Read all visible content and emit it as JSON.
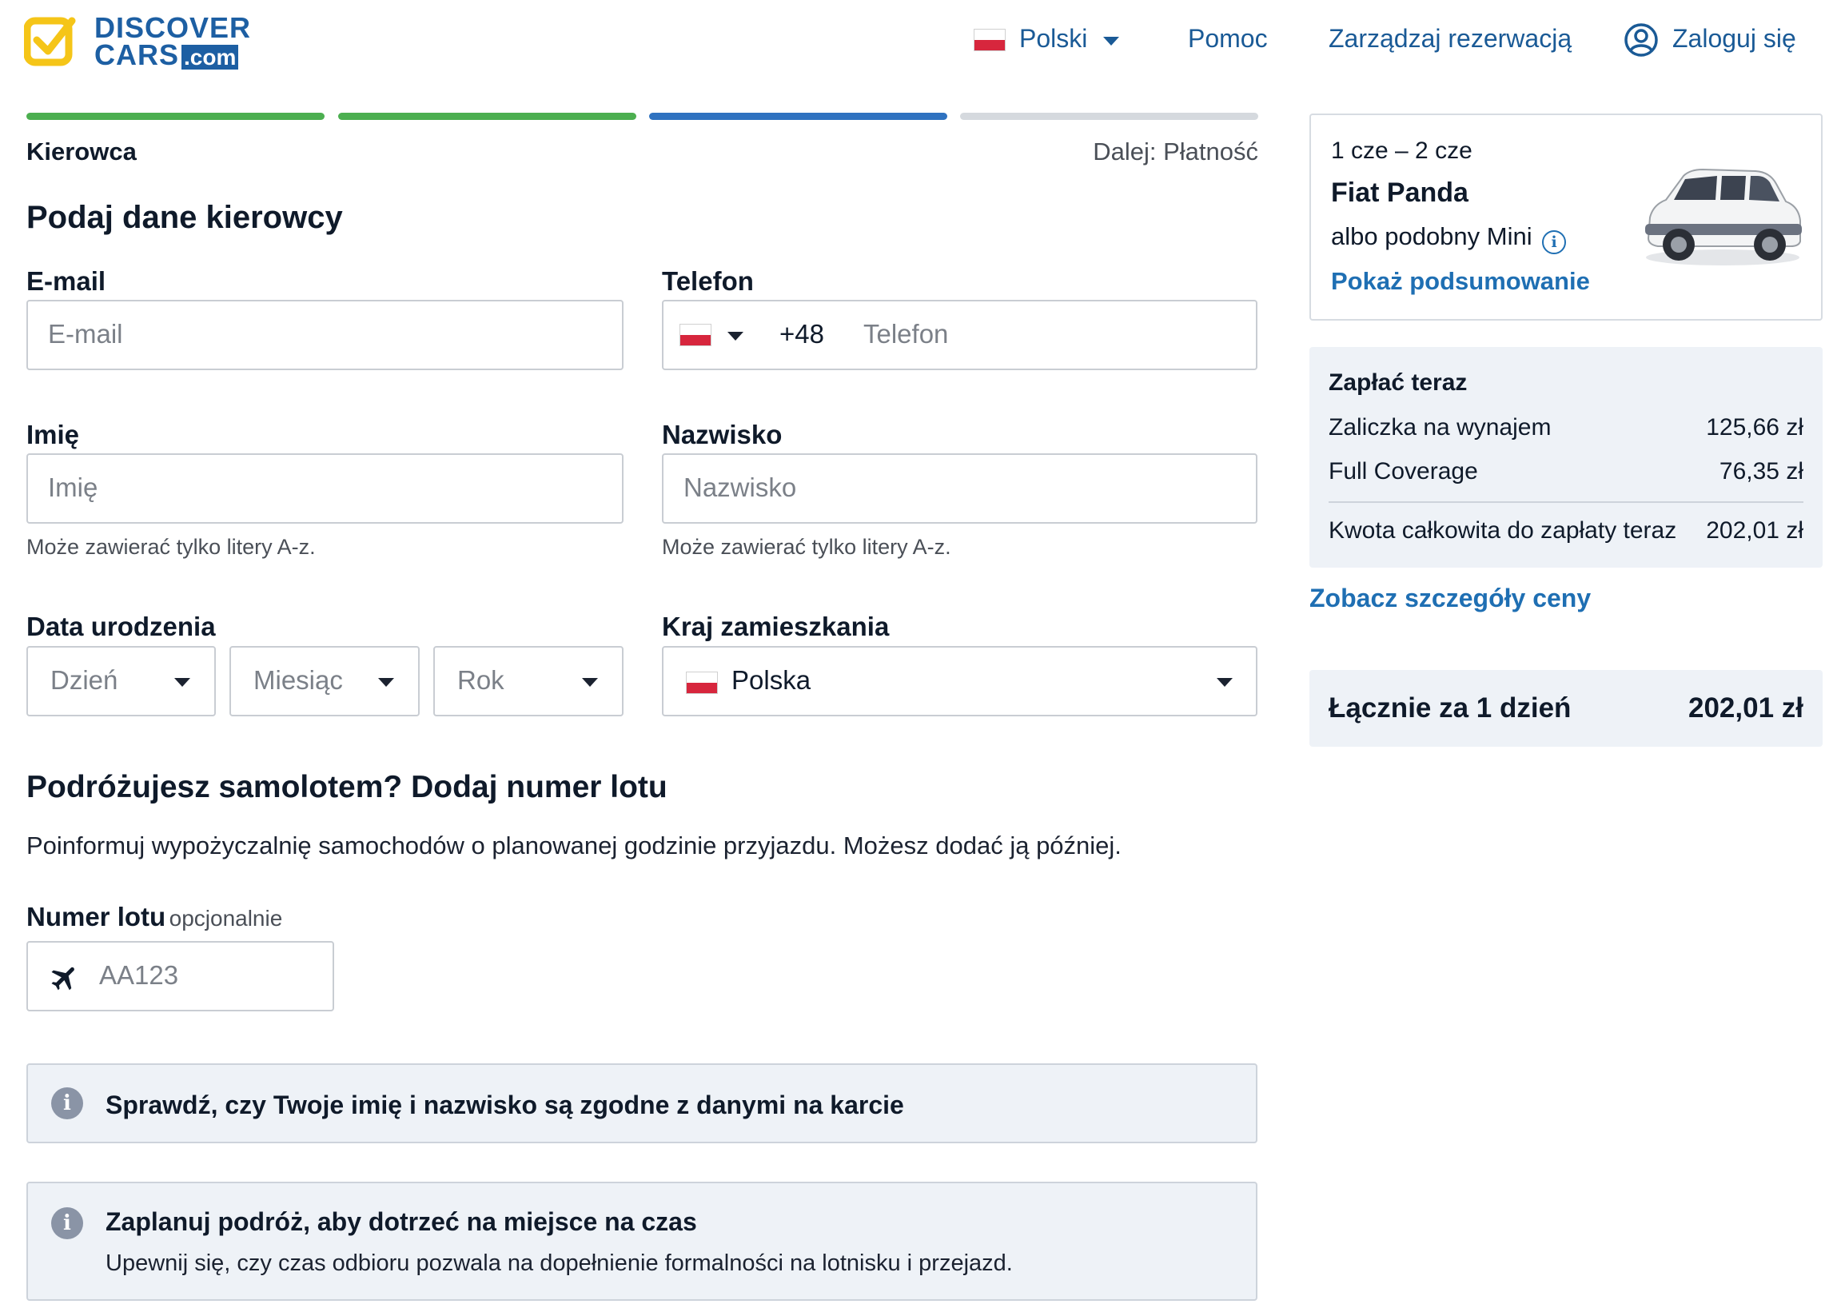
{
  "header": {
    "logo_line1": "DISCOVER",
    "logo_line2": "CARS",
    "logo_domain": ".com",
    "language": "Polski",
    "help": "Pomoc",
    "manage_booking": "Zarządzaj rezerwacją",
    "login": "Zaloguj się"
  },
  "progress": {
    "steps_total": 4,
    "completed": 2,
    "current": 3,
    "current_step_label": "Kierowca",
    "next_step_label": "Dalej: Płatność"
  },
  "form": {
    "title": "Podaj dane kierowcy",
    "email": {
      "label": "E-mail",
      "placeholder": "E-mail"
    },
    "phone": {
      "label": "Telefon",
      "prefix": "+48",
      "placeholder": "Telefon"
    },
    "first_name": {
      "label": "Imię",
      "placeholder": "Imię",
      "hint": "Może zawierać tylko litery A-z."
    },
    "last_name": {
      "label": "Nazwisko",
      "placeholder": "Nazwisko",
      "hint": "Może zawierać tylko litery A-z."
    },
    "birth_date": {
      "label": "Data urodzenia",
      "day": "Dzień",
      "month": "Miesiąc",
      "year": "Rok"
    },
    "country": {
      "label": "Kraj zamieszkania",
      "value": "Polska"
    }
  },
  "flight": {
    "title": "Podróżujesz samolotem? Dodaj numer lotu",
    "description": "Poinformuj wypożyczalnię samochodów o planowanej godzinie przyjazdu. Możesz dodać ją później.",
    "label": "Numer lotu",
    "optional": "opcjonalnie",
    "placeholder": "AA123"
  },
  "notices": [
    {
      "title": "Sprawdź, czy Twoje imię i nazwisko są zgodne z danymi na karcie"
    },
    {
      "title": "Zaplanuj podróż, aby dotrzeć na miejsce na czas",
      "text": "Upewnij się, czy czas odbioru pozwala na dopełnienie formalności na lotnisku i przejazd."
    }
  ],
  "car": {
    "dates": "1 cze – 2 cze",
    "name": "Fiat Panda",
    "category": "albo podobny Mini",
    "summary_link": "Pokaż podsumowanie"
  },
  "payment": {
    "title": "Zapłać teraz",
    "rows": [
      {
        "label": "Zaliczka na wynajem",
        "value": "125,66 zł"
      },
      {
        "label": "Full Coverage",
        "value": "76,35 zł"
      }
    ],
    "total_label": "Kwota całkowita do zapłaty teraz",
    "total_value": "202,01 zł",
    "details_link": "Zobacz szczegóły ceny"
  },
  "grand_total": {
    "label": "Łącznie za 1 dzień",
    "value": "202,01 zł"
  },
  "colors": {
    "progress_done": "#4caf50",
    "progress_current": "#2f72c0",
    "progress_pending": "#d5d9de",
    "link": "#1f6fb3",
    "logo_yellow": "#f5c518",
    "logo_blue": "#1d5fa3"
  }
}
